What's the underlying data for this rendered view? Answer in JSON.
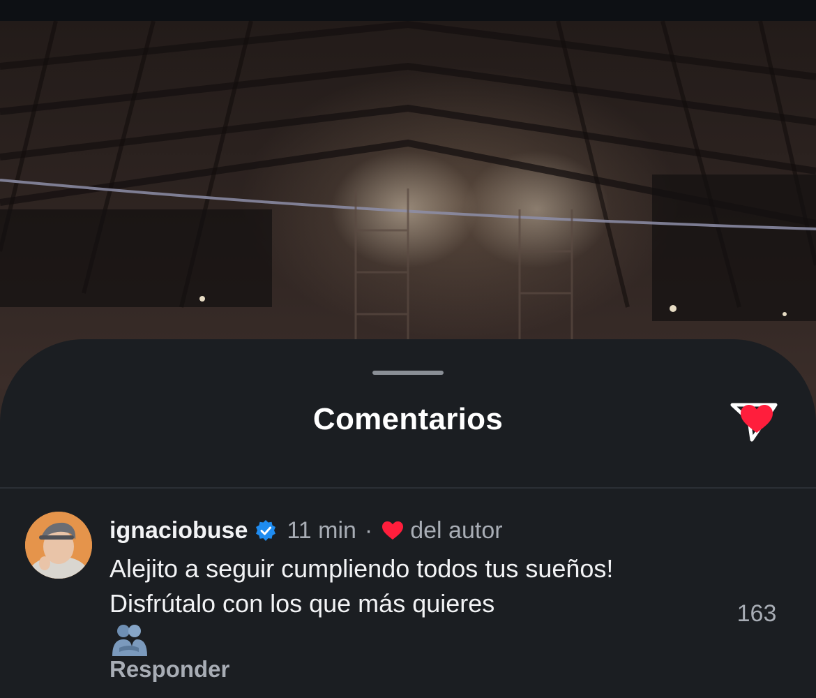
{
  "sheet": {
    "title": "Comentarios"
  },
  "comment": {
    "username": "ignaciobuse",
    "time": "11 min",
    "separator": "·",
    "liked_by_author_label": "del autor",
    "text": "Alejito a seguir cumpliendo todos tus sueños! Disfrútalo con los que más quieres",
    "emoji": "people-hugging",
    "reply_label": "Responder",
    "like_count": "163"
  },
  "icons": {
    "share": "paper-plane-icon",
    "verified": "verified-badge-icon",
    "like": "heart-icon"
  },
  "colors": {
    "sheet_background": "#1b1e22",
    "primary_text": "#f2f3f5",
    "secondary_text": "#a8adb5",
    "like_red": "#ff1e3c",
    "verified_blue": "#1f8cf0"
  }
}
